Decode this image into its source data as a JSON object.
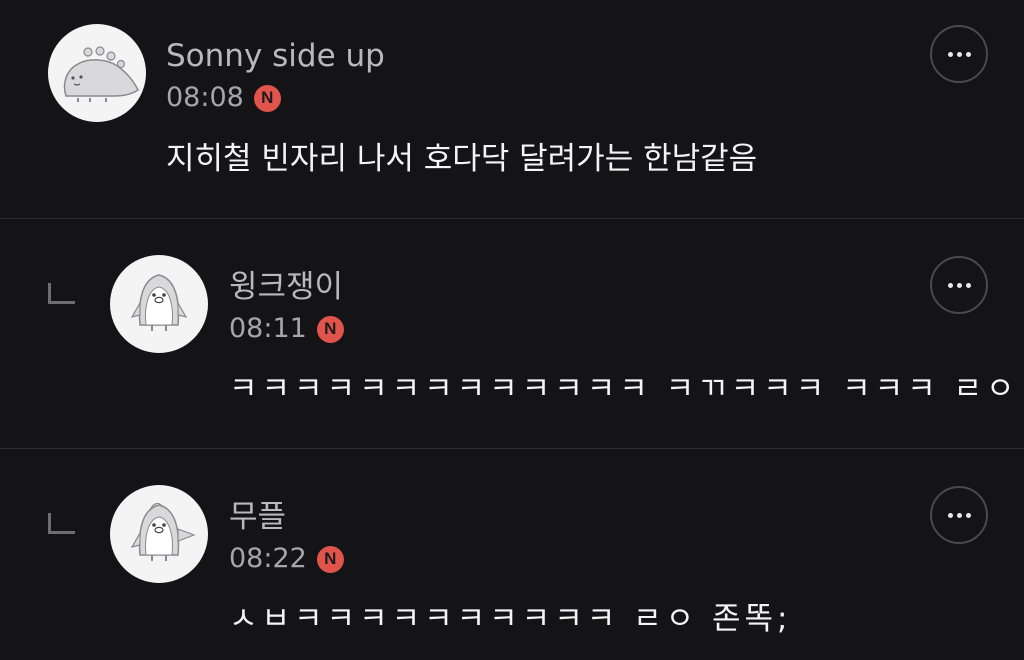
{
  "comments": [
    {
      "author": "Sonny side up",
      "time": "08:08",
      "badge": "N",
      "text": "지히철 빈자리 나서 호다닥 달려가는 한남같음",
      "avatar_icon": "dinosaur-avatar-icon",
      "is_reply": false
    },
    {
      "author": "윙크쟁이",
      "time": "08:11",
      "badge": "N",
      "text": "ㅋㅋㅋㅋㅋㅋㅋㅋㅋㅋㅋㅋㅋ ㅋㄲㅋㅋㅋ ㅋㅋㅋ ㄹㅇ",
      "avatar_icon": "penguin-avatar-icon",
      "is_reply": true
    },
    {
      "author": "무플",
      "time": "08:22",
      "badge": "N",
      "text": "ㅅㅂㅋㅋㅋㅋㅋㅋㅋㅋㅋㅋ ㄹㅇ 존똑;",
      "avatar_icon": "penguin-waving-avatar-icon",
      "is_reply": true
    }
  ],
  "colors": {
    "background": "#141416",
    "badge": "#e0544b",
    "divider": "#2e2e31"
  }
}
